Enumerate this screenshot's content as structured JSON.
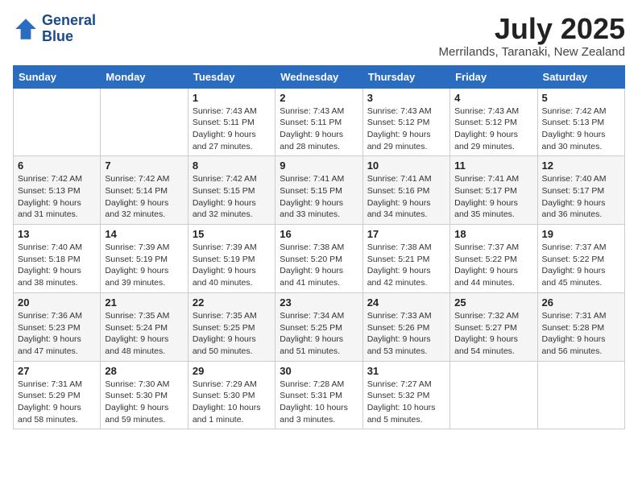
{
  "logo": {
    "line1": "General",
    "line2": "Blue"
  },
  "title": {
    "month_year": "July 2025",
    "location": "Merrilands, Taranaki, New Zealand"
  },
  "weekdays": [
    "Sunday",
    "Monday",
    "Tuesday",
    "Wednesday",
    "Thursday",
    "Friday",
    "Saturday"
  ],
  "weeks": [
    [
      {
        "day": "",
        "sunrise": "",
        "sunset": "",
        "daylight": ""
      },
      {
        "day": "",
        "sunrise": "",
        "sunset": "",
        "daylight": ""
      },
      {
        "day": "1",
        "sunrise": "Sunrise: 7:43 AM",
        "sunset": "Sunset: 5:11 PM",
        "daylight": "Daylight: 9 hours and 27 minutes."
      },
      {
        "day": "2",
        "sunrise": "Sunrise: 7:43 AM",
        "sunset": "Sunset: 5:11 PM",
        "daylight": "Daylight: 9 hours and 28 minutes."
      },
      {
        "day": "3",
        "sunrise": "Sunrise: 7:43 AM",
        "sunset": "Sunset: 5:12 PM",
        "daylight": "Daylight: 9 hours and 29 minutes."
      },
      {
        "day": "4",
        "sunrise": "Sunrise: 7:43 AM",
        "sunset": "Sunset: 5:12 PM",
        "daylight": "Daylight: 9 hours and 29 minutes."
      },
      {
        "day": "5",
        "sunrise": "Sunrise: 7:42 AM",
        "sunset": "Sunset: 5:13 PM",
        "daylight": "Daylight: 9 hours and 30 minutes."
      }
    ],
    [
      {
        "day": "6",
        "sunrise": "Sunrise: 7:42 AM",
        "sunset": "Sunset: 5:13 PM",
        "daylight": "Daylight: 9 hours and 31 minutes."
      },
      {
        "day": "7",
        "sunrise": "Sunrise: 7:42 AM",
        "sunset": "Sunset: 5:14 PM",
        "daylight": "Daylight: 9 hours and 32 minutes."
      },
      {
        "day": "8",
        "sunrise": "Sunrise: 7:42 AM",
        "sunset": "Sunset: 5:15 PM",
        "daylight": "Daylight: 9 hours and 32 minutes."
      },
      {
        "day": "9",
        "sunrise": "Sunrise: 7:41 AM",
        "sunset": "Sunset: 5:15 PM",
        "daylight": "Daylight: 9 hours and 33 minutes."
      },
      {
        "day": "10",
        "sunrise": "Sunrise: 7:41 AM",
        "sunset": "Sunset: 5:16 PM",
        "daylight": "Daylight: 9 hours and 34 minutes."
      },
      {
        "day": "11",
        "sunrise": "Sunrise: 7:41 AM",
        "sunset": "Sunset: 5:17 PM",
        "daylight": "Daylight: 9 hours and 35 minutes."
      },
      {
        "day": "12",
        "sunrise": "Sunrise: 7:40 AM",
        "sunset": "Sunset: 5:17 PM",
        "daylight": "Daylight: 9 hours and 36 minutes."
      }
    ],
    [
      {
        "day": "13",
        "sunrise": "Sunrise: 7:40 AM",
        "sunset": "Sunset: 5:18 PM",
        "daylight": "Daylight: 9 hours and 38 minutes."
      },
      {
        "day": "14",
        "sunrise": "Sunrise: 7:39 AM",
        "sunset": "Sunset: 5:19 PM",
        "daylight": "Daylight: 9 hours and 39 minutes."
      },
      {
        "day": "15",
        "sunrise": "Sunrise: 7:39 AM",
        "sunset": "Sunset: 5:19 PM",
        "daylight": "Daylight: 9 hours and 40 minutes."
      },
      {
        "day": "16",
        "sunrise": "Sunrise: 7:38 AM",
        "sunset": "Sunset: 5:20 PM",
        "daylight": "Daylight: 9 hours and 41 minutes."
      },
      {
        "day": "17",
        "sunrise": "Sunrise: 7:38 AM",
        "sunset": "Sunset: 5:21 PM",
        "daylight": "Daylight: 9 hours and 42 minutes."
      },
      {
        "day": "18",
        "sunrise": "Sunrise: 7:37 AM",
        "sunset": "Sunset: 5:22 PM",
        "daylight": "Daylight: 9 hours and 44 minutes."
      },
      {
        "day": "19",
        "sunrise": "Sunrise: 7:37 AM",
        "sunset": "Sunset: 5:22 PM",
        "daylight": "Daylight: 9 hours and 45 minutes."
      }
    ],
    [
      {
        "day": "20",
        "sunrise": "Sunrise: 7:36 AM",
        "sunset": "Sunset: 5:23 PM",
        "daylight": "Daylight: 9 hours and 47 minutes."
      },
      {
        "day": "21",
        "sunrise": "Sunrise: 7:35 AM",
        "sunset": "Sunset: 5:24 PM",
        "daylight": "Daylight: 9 hours and 48 minutes."
      },
      {
        "day": "22",
        "sunrise": "Sunrise: 7:35 AM",
        "sunset": "Sunset: 5:25 PM",
        "daylight": "Daylight: 9 hours and 50 minutes."
      },
      {
        "day": "23",
        "sunrise": "Sunrise: 7:34 AM",
        "sunset": "Sunset: 5:25 PM",
        "daylight": "Daylight: 9 hours and 51 minutes."
      },
      {
        "day": "24",
        "sunrise": "Sunrise: 7:33 AM",
        "sunset": "Sunset: 5:26 PM",
        "daylight": "Daylight: 9 hours and 53 minutes."
      },
      {
        "day": "25",
        "sunrise": "Sunrise: 7:32 AM",
        "sunset": "Sunset: 5:27 PM",
        "daylight": "Daylight: 9 hours and 54 minutes."
      },
      {
        "day": "26",
        "sunrise": "Sunrise: 7:31 AM",
        "sunset": "Sunset: 5:28 PM",
        "daylight": "Daylight: 9 hours and 56 minutes."
      }
    ],
    [
      {
        "day": "27",
        "sunrise": "Sunrise: 7:31 AM",
        "sunset": "Sunset: 5:29 PM",
        "daylight": "Daylight: 9 hours and 58 minutes."
      },
      {
        "day": "28",
        "sunrise": "Sunrise: 7:30 AM",
        "sunset": "Sunset: 5:30 PM",
        "daylight": "Daylight: 9 hours and 59 minutes."
      },
      {
        "day": "29",
        "sunrise": "Sunrise: 7:29 AM",
        "sunset": "Sunset: 5:30 PM",
        "daylight": "Daylight: 10 hours and 1 minute."
      },
      {
        "day": "30",
        "sunrise": "Sunrise: 7:28 AM",
        "sunset": "Sunset: 5:31 PM",
        "daylight": "Daylight: 10 hours and 3 minutes."
      },
      {
        "day": "31",
        "sunrise": "Sunrise: 7:27 AM",
        "sunset": "Sunset: 5:32 PM",
        "daylight": "Daylight: 10 hours and 5 minutes."
      },
      {
        "day": "",
        "sunrise": "",
        "sunset": "",
        "daylight": ""
      },
      {
        "day": "",
        "sunrise": "",
        "sunset": "",
        "daylight": ""
      }
    ]
  ]
}
